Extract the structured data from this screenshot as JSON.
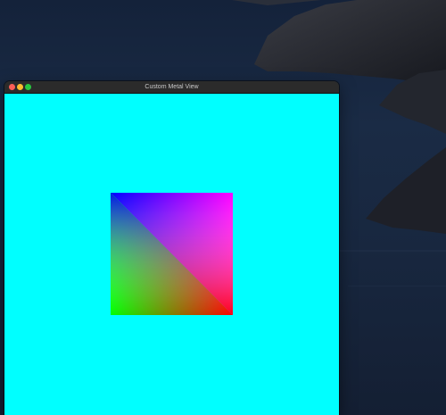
{
  "window": {
    "title": "Custom Metal View"
  },
  "metal_view": {
    "clear_color": "#00ffff",
    "quad_vertex_colors": {
      "top_left": "#0000ff",
      "top_right": "#ff00ff",
      "bottom_left": "#00ff00",
      "bottom_right": "#ff0000"
    }
  }
}
